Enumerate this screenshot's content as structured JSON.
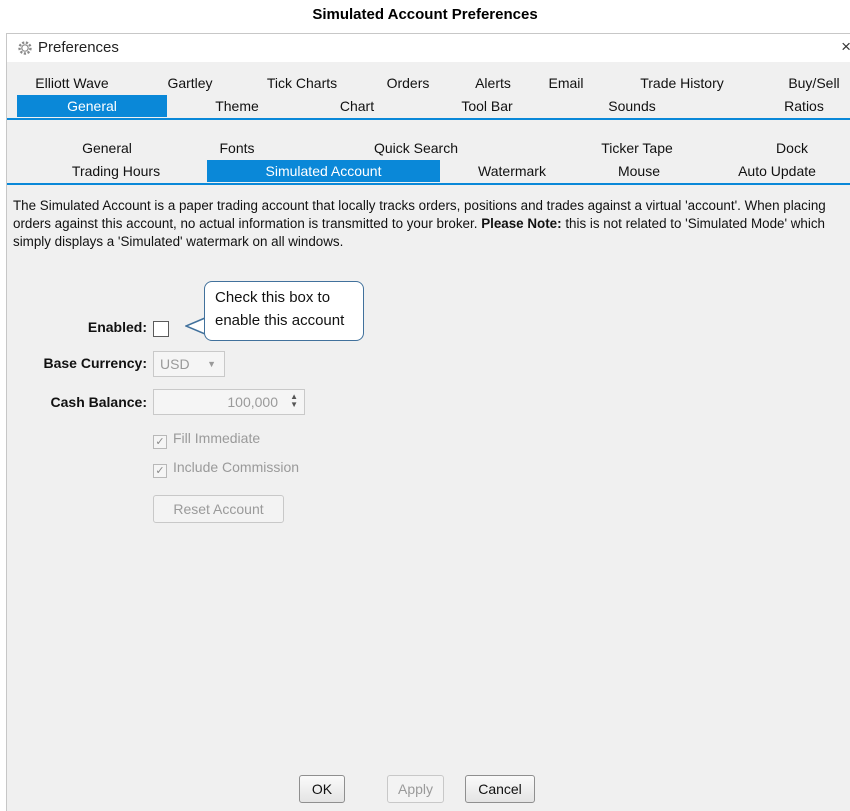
{
  "caption": "Simulated Account Preferences",
  "window": {
    "title": "Preferences",
    "close": "×"
  },
  "top_tabs": {
    "row1": [
      "Elliott Wave",
      "Gartley",
      "Tick Charts",
      "Orders",
      "Alerts",
      "Email",
      "Trade History",
      "Buy/Sell"
    ],
    "row2": [
      "General",
      "Theme",
      "Chart",
      "Tool Bar",
      "Sounds",
      "Ratios"
    ],
    "active": "General"
  },
  "sub_tabs": {
    "row1": [
      "General",
      "Fonts",
      "Quick Search",
      "Ticker Tape",
      "Dock"
    ],
    "row2": [
      "Trading Hours",
      "Simulated Account",
      "Watermark",
      "Mouse",
      "Auto Update"
    ],
    "active": "Simulated Account"
  },
  "description": {
    "part1": "The Simulated Account is a paper trading account that locally tracks orders, positions and trades against a virtual 'account'. When placing orders against this account, no actual information is transmitted to your broker.",
    "note_label": "Please Note:",
    "part2": "this is not related to 'Simulated Mode' which simply displays a 'Simulated' watermark on all windows."
  },
  "form": {
    "enabled_label": "Enabled:",
    "enabled_checked": false,
    "currency_label": "Base Currency:",
    "currency_value": "USD",
    "cash_label": "Cash Balance:",
    "cash_value": "100,000",
    "fill_immediate": "Fill Immediate",
    "include_commission": "Include Commission",
    "fill_checked_glyph": "✓",
    "commission_checked_glyph": "✓",
    "reset_button": "Reset Account"
  },
  "callout": {
    "line1": "Check this box to",
    "line2": "enable this account"
  },
  "buttons": {
    "ok": "OK",
    "apply": "Apply",
    "cancel": "Cancel"
  },
  "colors": {
    "accent": "#0a88d8",
    "window_bg": "#f0f0f0",
    "callout_border": "#41719c"
  }
}
